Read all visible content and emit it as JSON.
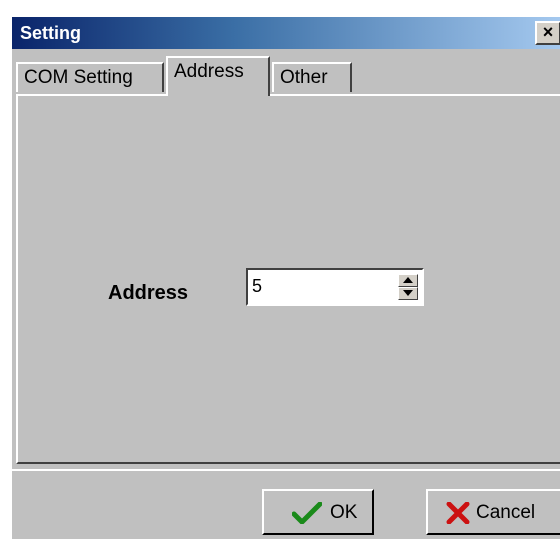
{
  "window": {
    "title": "Setting",
    "close_glyph": "×"
  },
  "tabs": [
    {
      "label": "COM Setting",
      "active": false
    },
    {
      "label": "Address",
      "active": true
    },
    {
      "label": "Other",
      "active": false
    }
  ],
  "address_panel": {
    "label": "Address",
    "value": "5"
  },
  "buttons": {
    "ok_label": "OK",
    "cancel_label": "Cancel"
  },
  "icons": {
    "ok": "checkmark-icon",
    "cancel": "x-cross-icon",
    "spin_up": "triangle-up-icon",
    "spin_down": "triangle-down-icon"
  },
  "colors": {
    "face": "#c0c0c0",
    "title_gradient_start": "#0a246a",
    "title_gradient_end": "#a6caf0",
    "ok_icon": "#1a8a1a",
    "cancel_icon": "#cc1111"
  }
}
